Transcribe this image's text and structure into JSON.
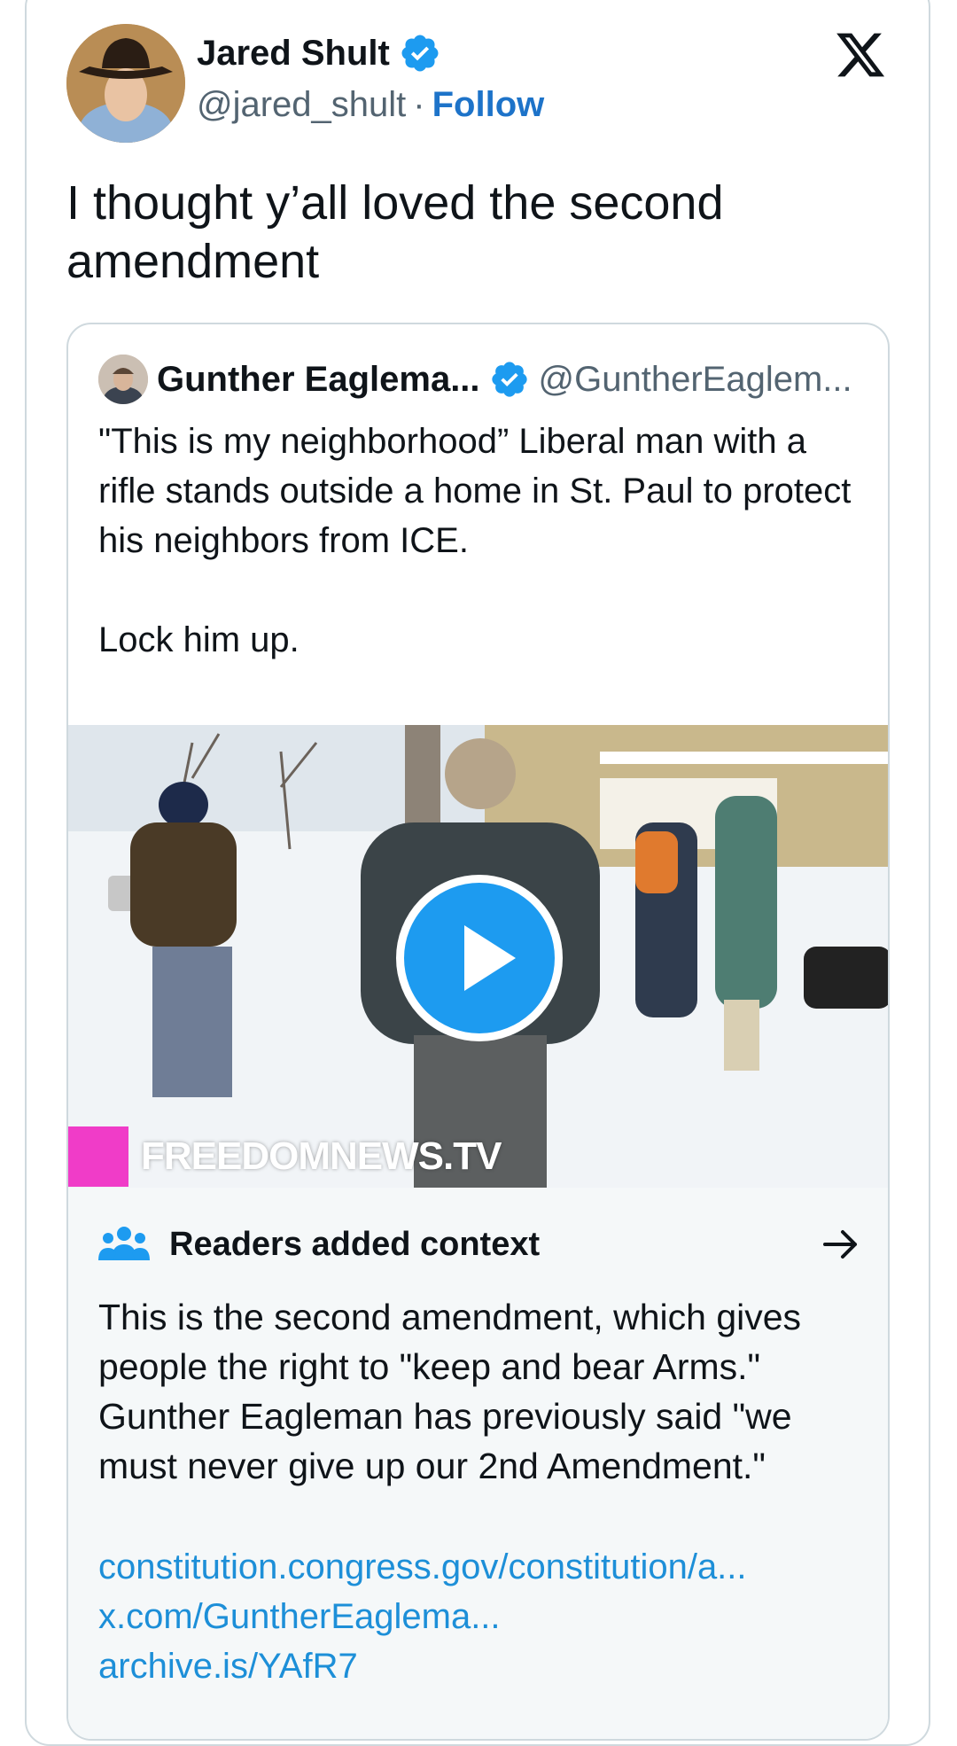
{
  "author": {
    "display_name": "Jared Shult",
    "handle": "@jared_shult",
    "separator": "·",
    "follow_label": "Follow",
    "verified_color": "#1d9bf0"
  },
  "tweet": {
    "text": "I thought y’all loved the second amendment"
  },
  "quoted_tweet": {
    "display_name": "Gunther Eaglema...",
    "handle": "@GuntherEaglem...",
    "text": "\"This is my neighborhood” Liberal man with a rifle stands outside a home in St. Paul to protect his neighbors from ICE.\n\nLock him up.",
    "media": {
      "type": "video",
      "watermark": "FREEDOMNEWS.TV",
      "play_icon": "play-icon"
    }
  },
  "community_note": {
    "title": "Readers added context",
    "text": "This is the second amendment, which gives people the right to \"keep and bear Arms.\" Gunther Eagleman has previously said \"we must never give up our 2nd Amendment.\"",
    "links": [
      "constitution.congress.gov/constitution/a...",
      "x.com/GuntherEaglema...",
      "archive.is/YAfR7"
    ],
    "link_color": "#1d8fd8"
  },
  "icons": {
    "logo": "x-logo-icon",
    "verified": "verified-badge-icon",
    "notes": "people-icon",
    "open": "arrow-right-icon"
  }
}
